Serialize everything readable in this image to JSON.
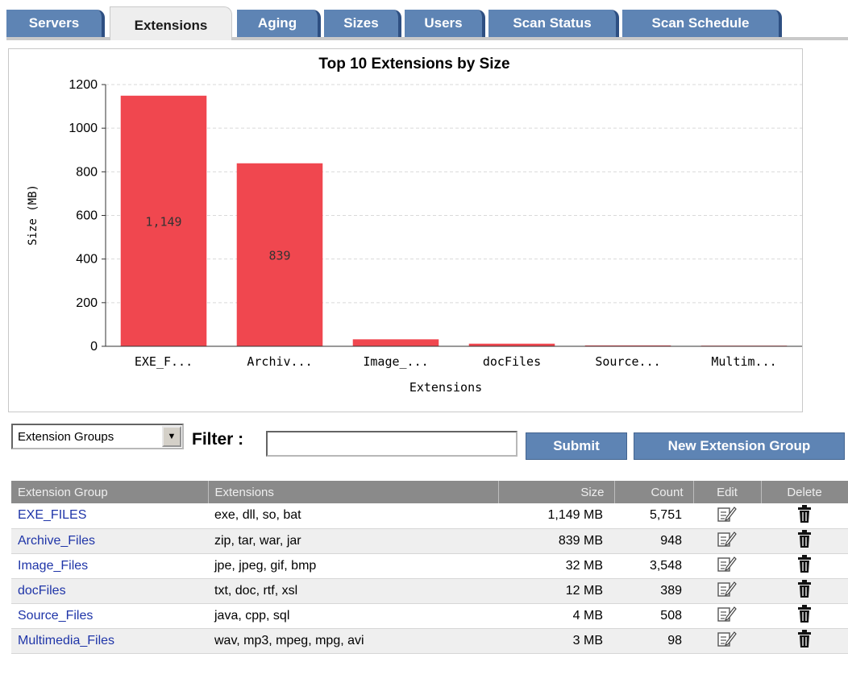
{
  "tabs": [
    {
      "label": "Servers",
      "active": false
    },
    {
      "label": "Extensions",
      "active": true
    },
    {
      "label": "Aging",
      "active": false
    },
    {
      "label": "Sizes",
      "active": false
    },
    {
      "label": "Users",
      "active": false
    },
    {
      "label": "Scan Status",
      "active": false
    },
    {
      "label": "Scan Schedule",
      "active": false
    }
  ],
  "chart_data": {
    "type": "bar",
    "title": "Top 10 Extensions by Size",
    "xlabel": "Extensions",
    "ylabel": "Size (MB)",
    "ylim": [
      0,
      1200
    ],
    "yticks": [
      0,
      200,
      400,
      600,
      800,
      1000,
      1200
    ],
    "grid": true,
    "categories": [
      "EXE_F...",
      "Archiv...",
      "Image_...",
      "docFiles",
      "Source...",
      "Multim..."
    ],
    "values": [
      1149,
      839,
      32,
      12,
      4,
      3
    ],
    "data_labels": [
      "1,149",
      "839",
      "",
      "",
      "",
      ""
    ],
    "bar_color": "#f0474f"
  },
  "controls": {
    "select_value": "Extension Groups",
    "filter_label": "Filter :",
    "filter_value": "",
    "submit_label": "Submit",
    "new_group_label": "New Extension Group"
  },
  "table": {
    "headers": [
      "Extension Group",
      "Extensions",
      "Size",
      "Count",
      "Edit",
      "Delete"
    ],
    "rows": [
      {
        "group": "EXE_FILES",
        "extensions": "exe, dll, so, bat",
        "size": "1,149 MB",
        "count": "5,751"
      },
      {
        "group": "Archive_Files",
        "extensions": "zip, tar, war, jar",
        "size": "839 MB",
        "count": "948"
      },
      {
        "group": "Image_Files",
        "extensions": "jpe, jpeg, gif, bmp",
        "size": "32 MB",
        "count": "3,548"
      },
      {
        "group": "docFiles",
        "extensions": "txt, doc, rtf, xsl",
        "size": "12 MB",
        "count": "389"
      },
      {
        "group": "Source_Files",
        "extensions": "java, cpp, sql",
        "size": "4 MB",
        "count": "508"
      },
      {
        "group": "Multimedia_Files",
        "extensions": "wav, mp3, mpeg, mpg, avi",
        "size": "3 MB",
        "count": "98"
      }
    ]
  },
  "icons": {
    "edit": "edit-icon",
    "delete": "trash-icon",
    "dropdown": "chevron-down-icon"
  },
  "colors": {
    "tab": "#5e84b4",
    "button": "#5e84b4",
    "bar": "#f0474f",
    "link": "#1f35a8",
    "table_header": "#8a8a8a"
  }
}
